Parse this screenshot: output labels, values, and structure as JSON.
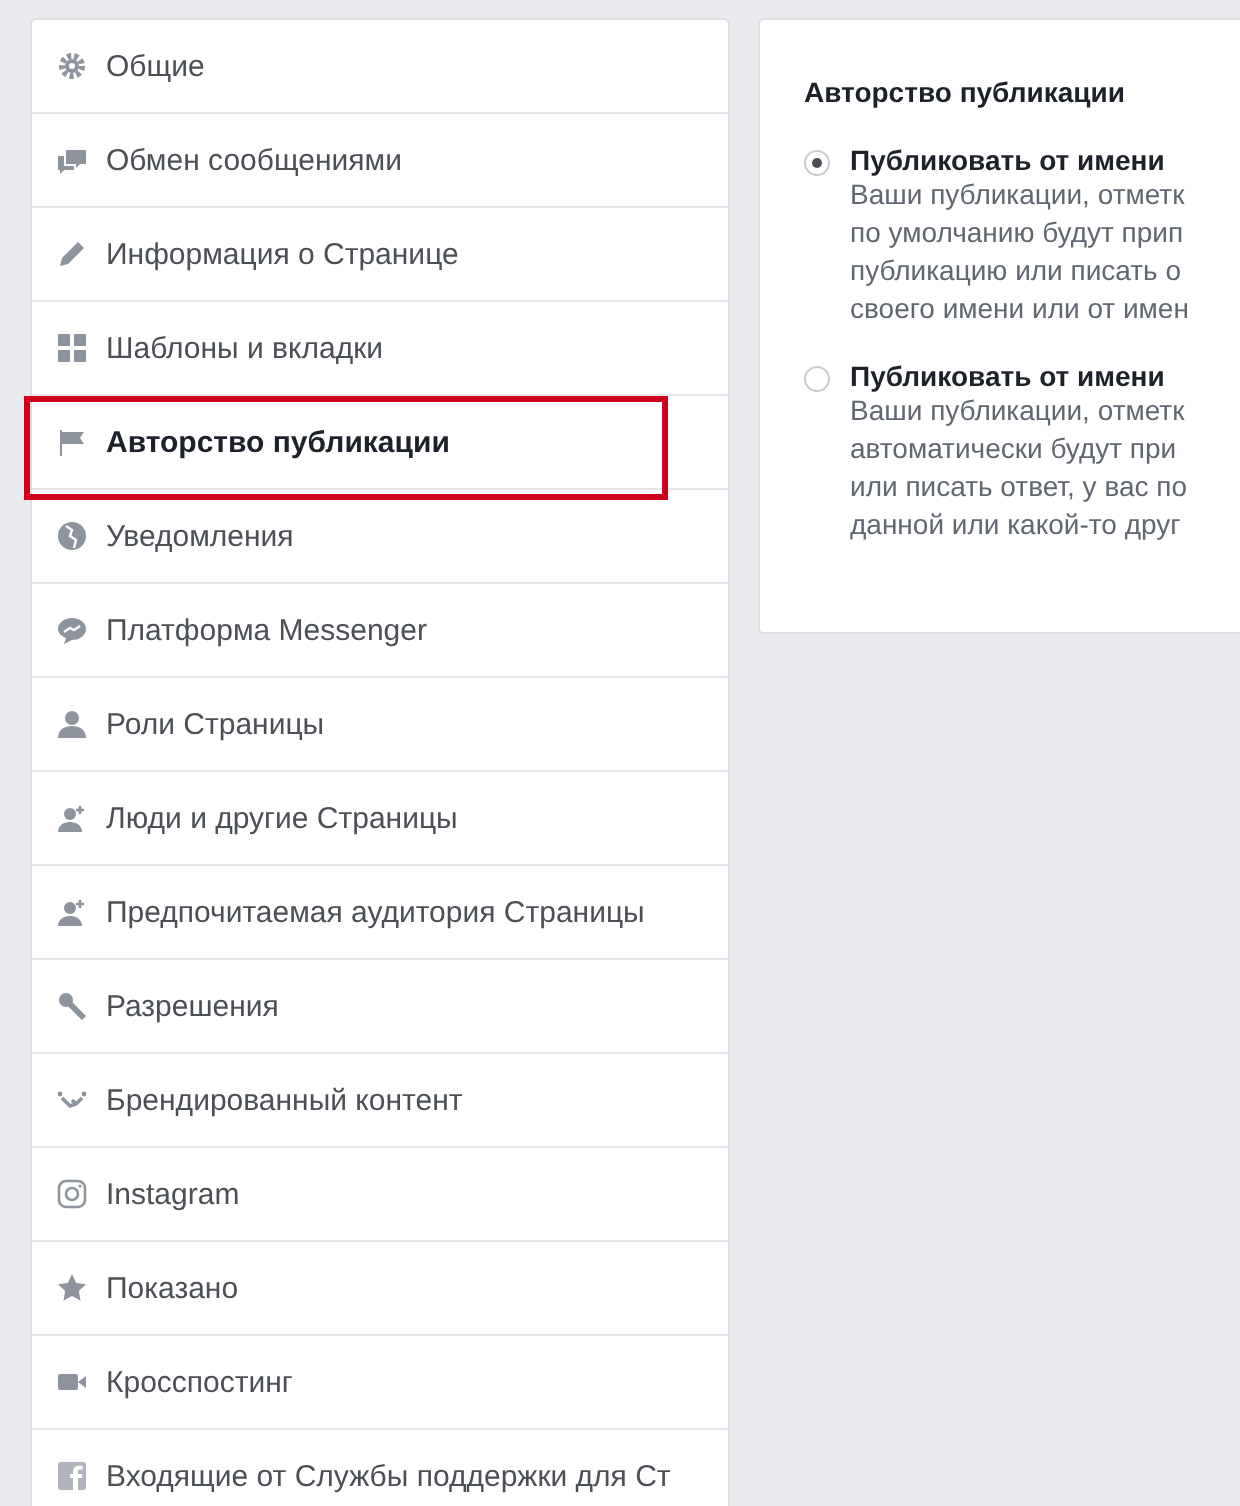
{
  "sidebar": {
    "items": [
      {
        "label": "Общие",
        "selected": false
      },
      {
        "label": "Обмен сообщениями",
        "selected": false
      },
      {
        "label": "Информация о Странице",
        "selected": false
      },
      {
        "label": "Шаблоны и вкладки",
        "selected": false
      },
      {
        "label": "Авторство публикации",
        "selected": true
      },
      {
        "label": "Уведомления",
        "selected": false
      },
      {
        "label": "Платформа Messenger",
        "selected": false
      },
      {
        "label": "Роли Страницы",
        "selected": false
      },
      {
        "label": "Люди и другие Страницы",
        "selected": false
      },
      {
        "label": "Предпочитаемая аудитория Страницы",
        "selected": false
      },
      {
        "label": "Разрешения",
        "selected": false
      },
      {
        "label": "Брендированный контент",
        "selected": false
      },
      {
        "label": "Instagram",
        "selected": false
      },
      {
        "label": "Показано",
        "selected": false
      },
      {
        "label": "Кросспостинг",
        "selected": false
      },
      {
        "label": "Входящие от Службы поддержки для Ст",
        "selected": false
      }
    ]
  },
  "panel": {
    "title": "Авторство публикации",
    "options": [
      {
        "label": "Публиковать от имени",
        "checked": true,
        "lines": [
          "Ваши публикации, отметк",
          "по умолчанию будут прип",
          "публикацию или писать о",
          "своего имени или от имен"
        ]
      },
      {
        "label": "Публиковать от имени",
        "checked": false,
        "lines": [
          "Ваши публикации, отметк",
          "автоматически будут при",
          "или писать ответ, у вас по",
          "данной или какой-то друг"
        ]
      }
    ]
  }
}
